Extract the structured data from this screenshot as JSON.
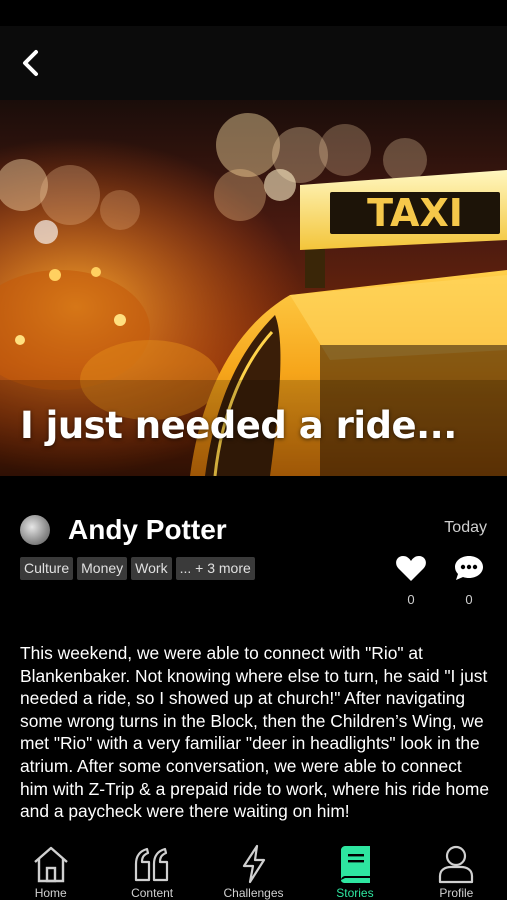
{
  "header": {
    "back_icon": "chevron-left-icon"
  },
  "story": {
    "title": "I just needed a ride...",
    "image_sign_text": "TAXI",
    "author": "Andy Potter",
    "date": "Today",
    "tags": [
      "Culture",
      "Money",
      "Work",
      "... + 3 more"
    ],
    "likes": "0",
    "comments": "0",
    "body": "This weekend, we were able to connect with \"Rio\" at Blankenbaker. Not knowing where else to turn, he said \"I just needed a ride, so I showed up at church!\" After navigating some wrong turns in the Block, then the Children’s Wing, we met \"Rio\" with a very familiar \"deer in headlights\" look in the atrium. After some conversation, we were able to connect him with Z-Trip & a prepaid ride to work, where his ride home and a paycheck were there waiting on him!"
  },
  "tabs": [
    {
      "label": "Home",
      "icon": "home-icon",
      "active": false
    },
    {
      "label": "Content",
      "icon": "quote-icon",
      "active": false
    },
    {
      "label": "Challenges",
      "icon": "lightning-icon",
      "active": false
    },
    {
      "label": "Stories",
      "icon": "book-icon",
      "active": true
    },
    {
      "label": "Profile",
      "icon": "person-icon",
      "active": false
    }
  ],
  "colors": {
    "accent": "#2ee6a0",
    "background": "#000000",
    "tag_bg": "#3a3a3a"
  }
}
